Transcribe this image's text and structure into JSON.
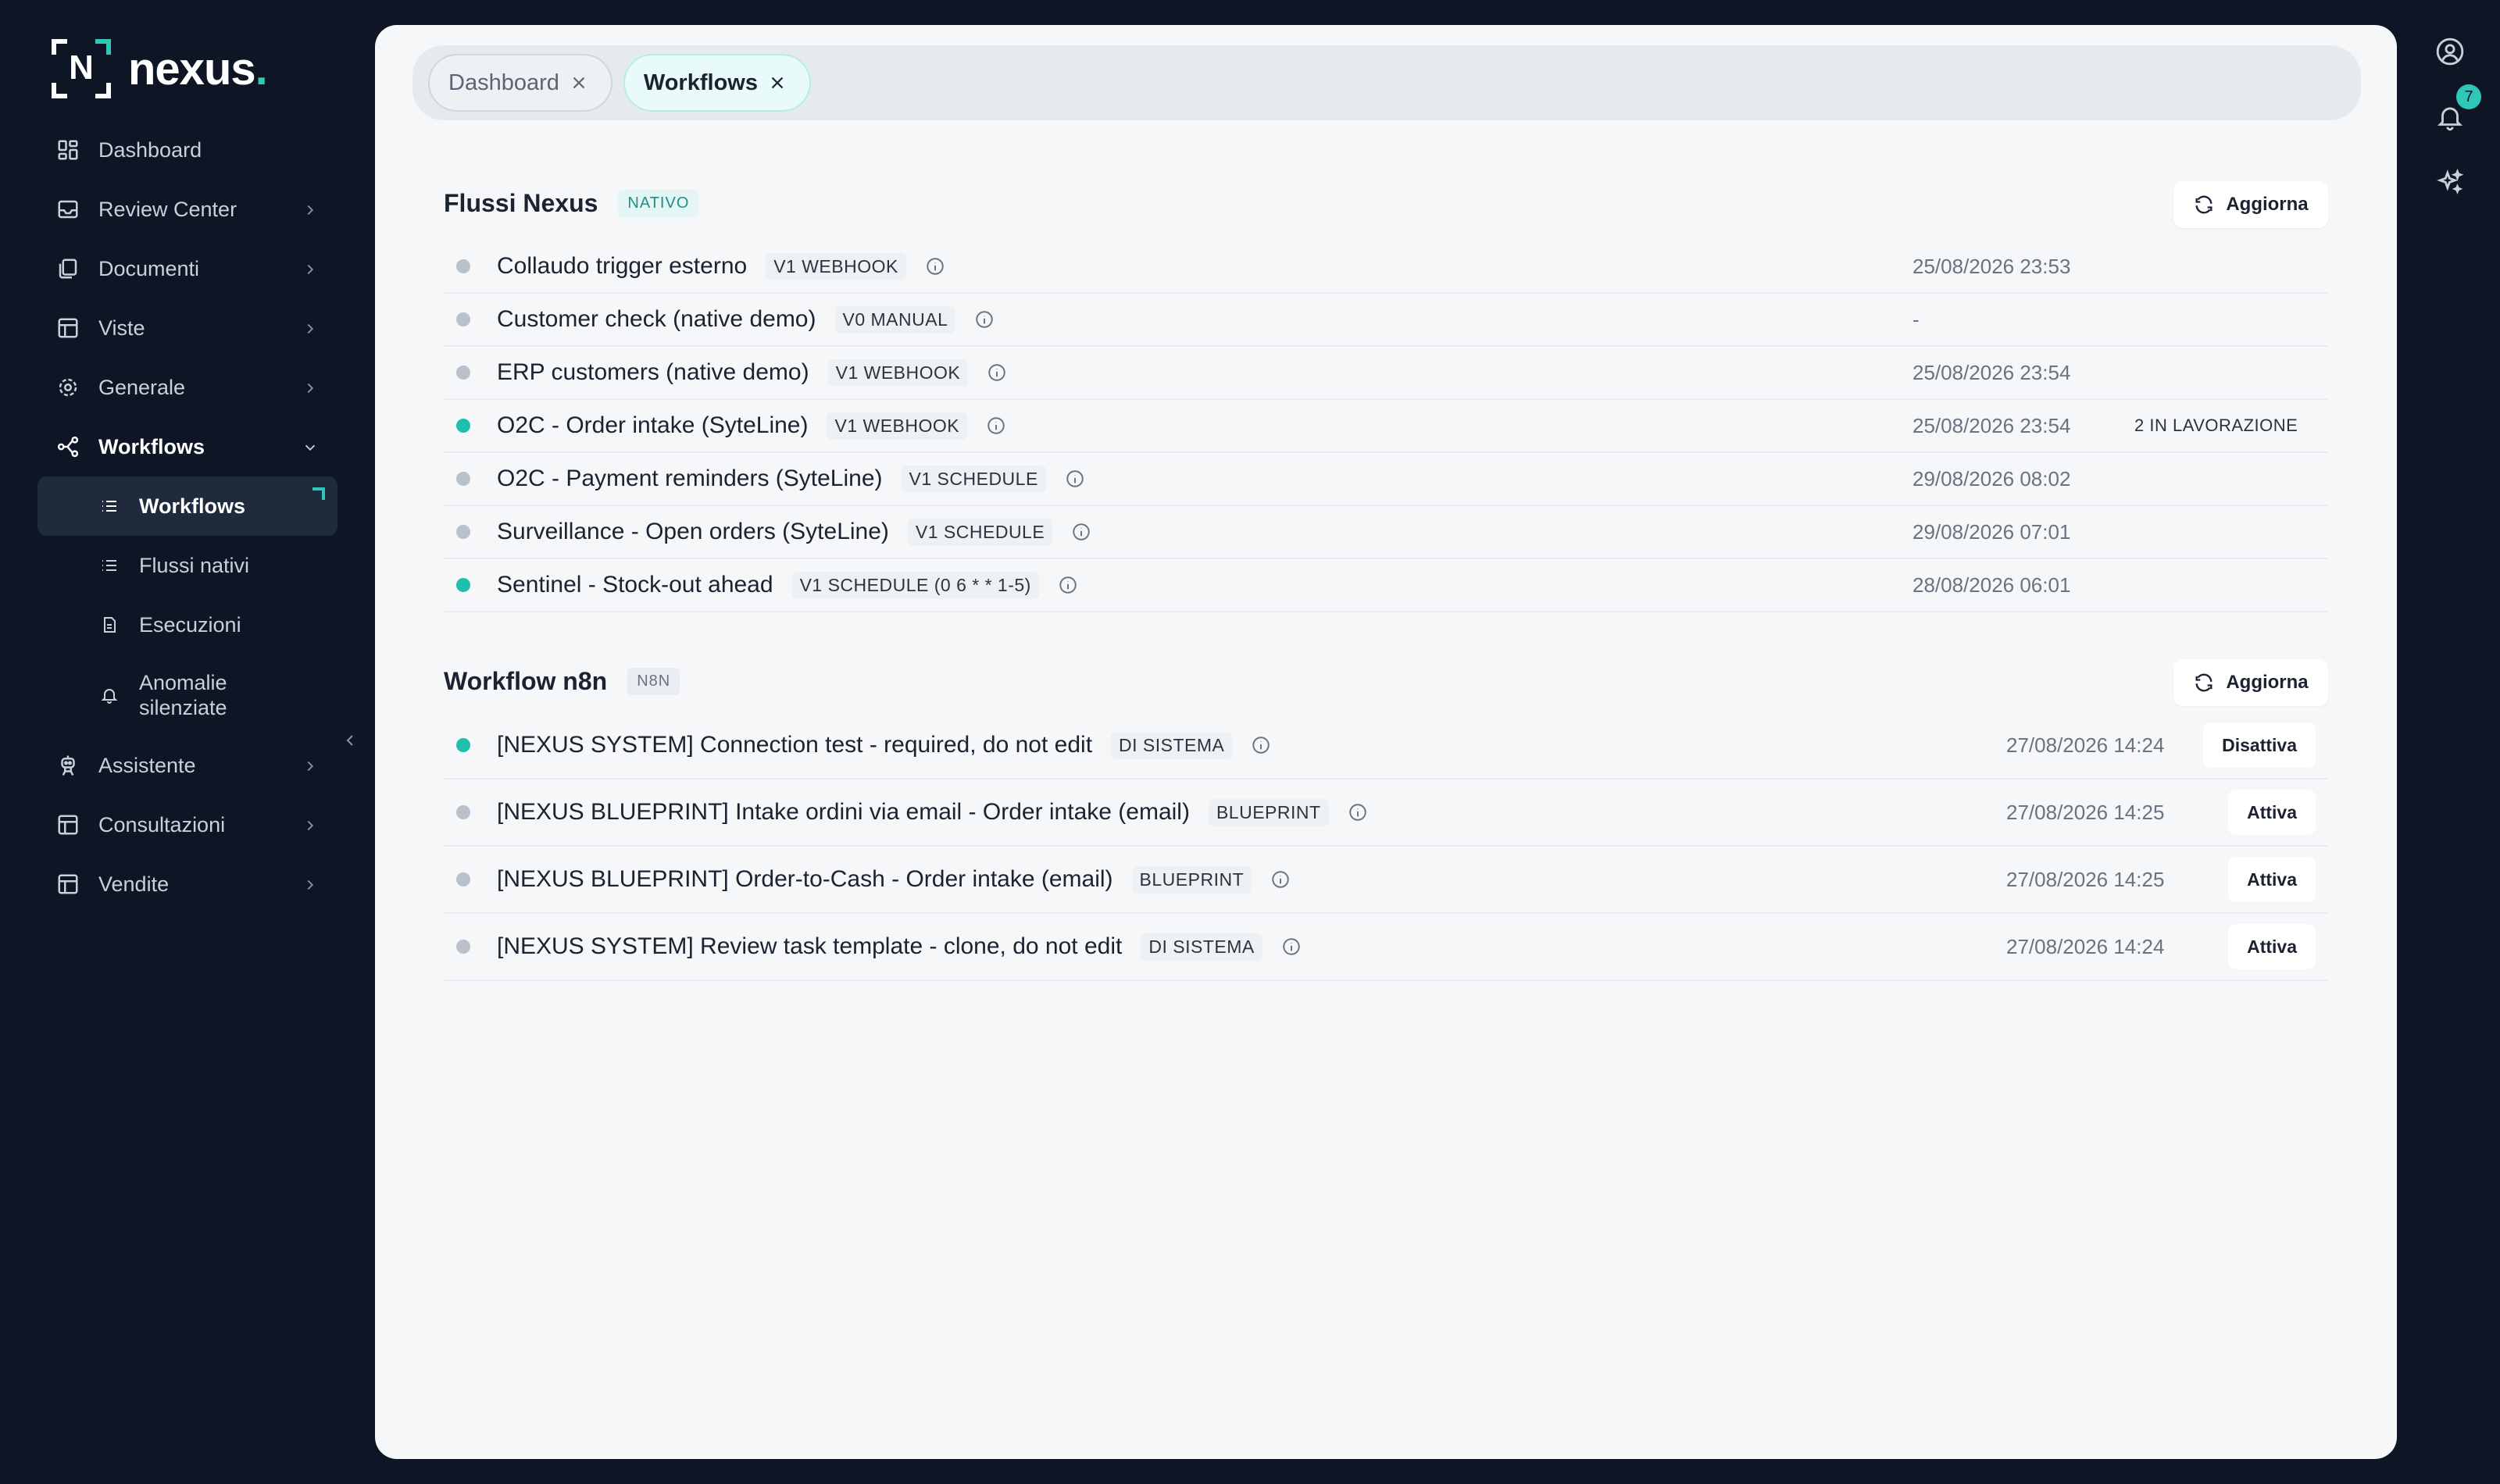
{
  "brand": {
    "mark_letter": "N",
    "name": "nexus",
    "dot": "."
  },
  "sidebar": {
    "items": [
      {
        "label": "Dashboard",
        "icon": "grid-icon"
      },
      {
        "label": "Review Center",
        "icon": "inbox-icon"
      },
      {
        "label": "Documenti",
        "icon": "documents-icon"
      },
      {
        "label": "Viste",
        "icon": "table-icon"
      },
      {
        "label": "Generale",
        "icon": "gear-icon"
      },
      {
        "label": "Workflows",
        "icon": "workflow-icon"
      },
      {
        "label": "Assistente",
        "icon": "robot-icon"
      },
      {
        "label": "Consultazioni",
        "icon": "table-icon"
      },
      {
        "label": "Vendite",
        "icon": "table-icon"
      }
    ],
    "workflow_subitems": [
      {
        "label": "Workflows"
      },
      {
        "label": "Flussi nativi"
      },
      {
        "label": "Esecuzioni"
      },
      {
        "label_line1": "Anomalie",
        "label_line2": "silenziate"
      }
    ]
  },
  "rail": {
    "notification_count": "7"
  },
  "tabs": [
    {
      "label": "Dashboard",
      "active": false
    },
    {
      "label": "Workflows",
      "active": true
    }
  ],
  "native": {
    "title": "Flussi Nexus",
    "tag": "NATIVO",
    "refresh_label": "Aggiorna",
    "rows": [
      {
        "name": "Collaudo trigger esterno",
        "chip": "V1 WEBHOOK",
        "date": "25/08/2026 23:53",
        "extra": "",
        "active": false
      },
      {
        "name": "Customer check (native demo)",
        "chip": "V0 MANUAL",
        "date": "-",
        "extra": "",
        "active": false
      },
      {
        "name": "ERP customers (native demo)",
        "chip": "V1 WEBHOOK",
        "date": "25/08/2026 23:54",
        "extra": "",
        "active": false
      },
      {
        "name": "O2C - Order intake (SyteLine)",
        "chip": "V1 WEBHOOK",
        "date": "25/08/2026 23:54",
        "extra": "2 IN LAVORAZIONE",
        "active": true
      },
      {
        "name": "O2C - Payment reminders (SyteLine)",
        "chip": "V1 SCHEDULE",
        "date": "29/08/2026 08:02",
        "extra": "",
        "active": false
      },
      {
        "name": "Surveillance - Open orders (SyteLine)",
        "chip": "V1 SCHEDULE",
        "date": "29/08/2026 07:01",
        "extra": "",
        "active": false
      },
      {
        "name": "Sentinel - Stock-out ahead",
        "chip": "V1 SCHEDULE (0 6 * * 1-5)",
        "date": "28/08/2026 06:01",
        "extra": "",
        "active": true
      }
    ]
  },
  "n8n": {
    "title": "Workflow n8n",
    "tag": "N8N",
    "refresh_label": "Aggiorna",
    "rows": [
      {
        "name": "[NEXUS SYSTEM] Connection test - required, do not edit",
        "chip": "DI SISTEMA",
        "date": "27/08/2026 14:24",
        "action": "Disattiva",
        "active": true
      },
      {
        "name": "[NEXUS BLUEPRINT] Intake ordini via email - Order intake (email)",
        "chip": "BLUEPRINT",
        "date": "27/08/2026 14:25",
        "action": "Attiva",
        "active": false
      },
      {
        "name": "[NEXUS BLUEPRINT] Order-to-Cash - Order intake (email)",
        "chip": "BLUEPRINT",
        "date": "27/08/2026 14:25",
        "action": "Attiva",
        "active": false
      },
      {
        "name": "[NEXUS SYSTEM] Review task template - clone, do not edit",
        "chip": "DI SISTEMA",
        "date": "27/08/2026 14:24",
        "action": "Attiva",
        "active": false
      }
    ]
  },
  "colors": {
    "accent": "#2ec7b8",
    "sidebar_bg": "#0e1626",
    "panel_bg": "#f5f7f9",
    "active_dot": "#1fbfae",
    "inactive_dot": "#b9c1ca"
  }
}
